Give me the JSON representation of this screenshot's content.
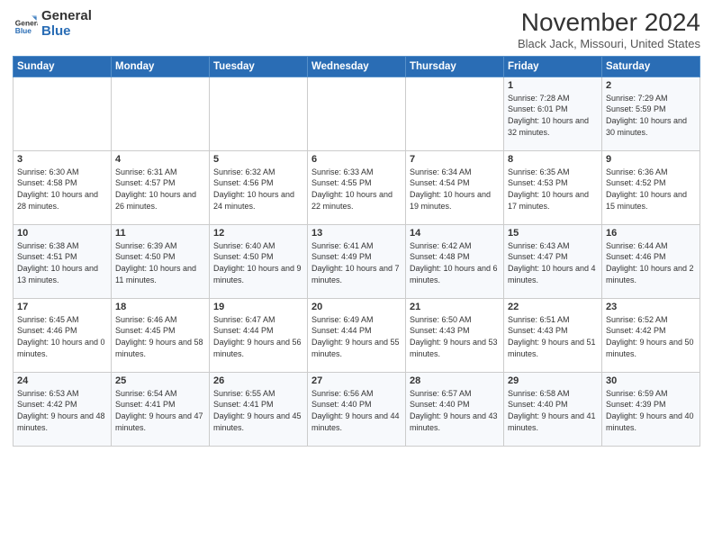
{
  "logo": {
    "line1": "General",
    "line2": "Blue"
  },
  "header": {
    "title": "November 2024",
    "location": "Black Jack, Missouri, United States"
  },
  "weekdays": [
    "Sunday",
    "Monday",
    "Tuesday",
    "Wednesday",
    "Thursday",
    "Friday",
    "Saturday"
  ],
  "weeks": [
    [
      {
        "day": "",
        "info": ""
      },
      {
        "day": "",
        "info": ""
      },
      {
        "day": "",
        "info": ""
      },
      {
        "day": "",
        "info": ""
      },
      {
        "day": "",
        "info": ""
      },
      {
        "day": "1",
        "info": "Sunrise: 7:28 AM\nSunset: 6:01 PM\nDaylight: 10 hours and 32 minutes."
      },
      {
        "day": "2",
        "info": "Sunrise: 7:29 AM\nSunset: 5:59 PM\nDaylight: 10 hours and 30 minutes."
      }
    ],
    [
      {
        "day": "3",
        "info": "Sunrise: 6:30 AM\nSunset: 4:58 PM\nDaylight: 10 hours and 28 minutes."
      },
      {
        "day": "4",
        "info": "Sunrise: 6:31 AM\nSunset: 4:57 PM\nDaylight: 10 hours and 26 minutes."
      },
      {
        "day": "5",
        "info": "Sunrise: 6:32 AM\nSunset: 4:56 PM\nDaylight: 10 hours and 24 minutes."
      },
      {
        "day": "6",
        "info": "Sunrise: 6:33 AM\nSunset: 4:55 PM\nDaylight: 10 hours and 22 minutes."
      },
      {
        "day": "7",
        "info": "Sunrise: 6:34 AM\nSunset: 4:54 PM\nDaylight: 10 hours and 19 minutes."
      },
      {
        "day": "8",
        "info": "Sunrise: 6:35 AM\nSunset: 4:53 PM\nDaylight: 10 hours and 17 minutes."
      },
      {
        "day": "9",
        "info": "Sunrise: 6:36 AM\nSunset: 4:52 PM\nDaylight: 10 hours and 15 minutes."
      }
    ],
    [
      {
        "day": "10",
        "info": "Sunrise: 6:38 AM\nSunset: 4:51 PM\nDaylight: 10 hours and 13 minutes."
      },
      {
        "day": "11",
        "info": "Sunrise: 6:39 AM\nSunset: 4:50 PM\nDaylight: 10 hours and 11 minutes."
      },
      {
        "day": "12",
        "info": "Sunrise: 6:40 AM\nSunset: 4:50 PM\nDaylight: 10 hours and 9 minutes."
      },
      {
        "day": "13",
        "info": "Sunrise: 6:41 AM\nSunset: 4:49 PM\nDaylight: 10 hours and 7 minutes."
      },
      {
        "day": "14",
        "info": "Sunrise: 6:42 AM\nSunset: 4:48 PM\nDaylight: 10 hours and 6 minutes."
      },
      {
        "day": "15",
        "info": "Sunrise: 6:43 AM\nSunset: 4:47 PM\nDaylight: 10 hours and 4 minutes."
      },
      {
        "day": "16",
        "info": "Sunrise: 6:44 AM\nSunset: 4:46 PM\nDaylight: 10 hours and 2 minutes."
      }
    ],
    [
      {
        "day": "17",
        "info": "Sunrise: 6:45 AM\nSunset: 4:46 PM\nDaylight: 10 hours and 0 minutes."
      },
      {
        "day": "18",
        "info": "Sunrise: 6:46 AM\nSunset: 4:45 PM\nDaylight: 9 hours and 58 minutes."
      },
      {
        "day": "19",
        "info": "Sunrise: 6:47 AM\nSunset: 4:44 PM\nDaylight: 9 hours and 56 minutes."
      },
      {
        "day": "20",
        "info": "Sunrise: 6:49 AM\nSunset: 4:44 PM\nDaylight: 9 hours and 55 minutes."
      },
      {
        "day": "21",
        "info": "Sunrise: 6:50 AM\nSunset: 4:43 PM\nDaylight: 9 hours and 53 minutes."
      },
      {
        "day": "22",
        "info": "Sunrise: 6:51 AM\nSunset: 4:43 PM\nDaylight: 9 hours and 51 minutes."
      },
      {
        "day": "23",
        "info": "Sunrise: 6:52 AM\nSunset: 4:42 PM\nDaylight: 9 hours and 50 minutes."
      }
    ],
    [
      {
        "day": "24",
        "info": "Sunrise: 6:53 AM\nSunset: 4:42 PM\nDaylight: 9 hours and 48 minutes."
      },
      {
        "day": "25",
        "info": "Sunrise: 6:54 AM\nSunset: 4:41 PM\nDaylight: 9 hours and 47 minutes."
      },
      {
        "day": "26",
        "info": "Sunrise: 6:55 AM\nSunset: 4:41 PM\nDaylight: 9 hours and 45 minutes."
      },
      {
        "day": "27",
        "info": "Sunrise: 6:56 AM\nSunset: 4:40 PM\nDaylight: 9 hours and 44 minutes."
      },
      {
        "day": "28",
        "info": "Sunrise: 6:57 AM\nSunset: 4:40 PM\nDaylight: 9 hours and 43 minutes."
      },
      {
        "day": "29",
        "info": "Sunrise: 6:58 AM\nSunset: 4:40 PM\nDaylight: 9 hours and 41 minutes."
      },
      {
        "day": "30",
        "info": "Sunrise: 6:59 AM\nSunset: 4:39 PM\nDaylight: 9 hours and 40 minutes."
      }
    ]
  ]
}
